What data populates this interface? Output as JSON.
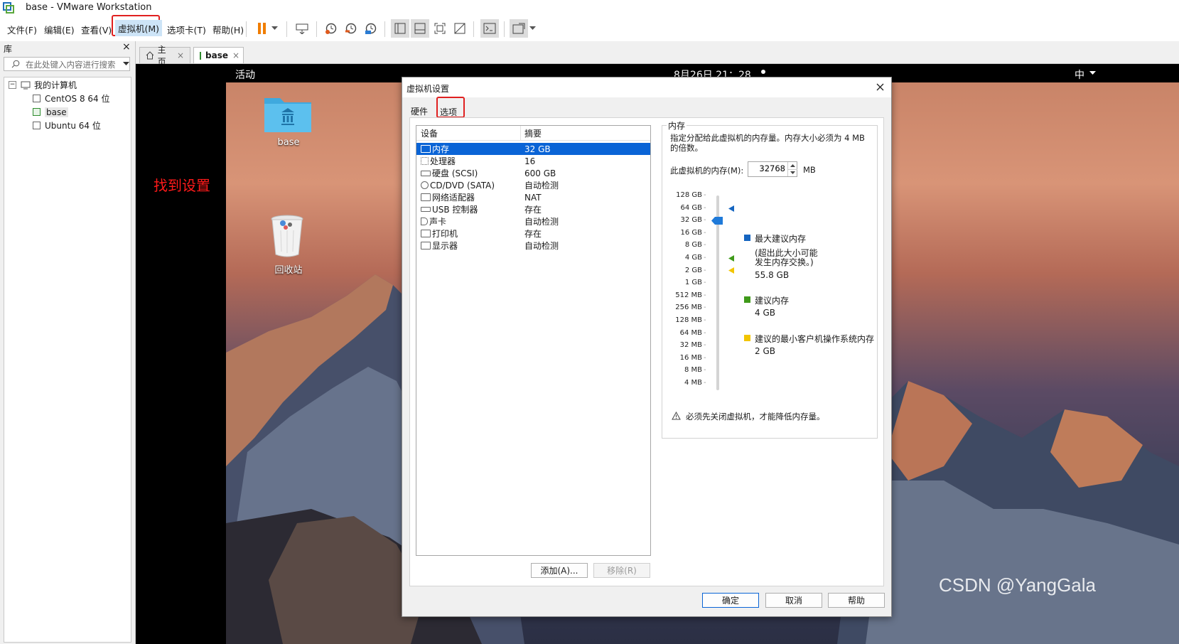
{
  "window": {
    "title": "base - VMware Workstation"
  },
  "menu": {
    "file": "文件(F)",
    "edit": "编辑(E)",
    "view": "查看(V)",
    "vm": "虚拟机(M)",
    "tabs": "选项卡(T)",
    "help": "帮助(H)"
  },
  "library": {
    "title": "库",
    "search_placeholder": "在此处键入内容进行搜索",
    "root": "我的计算机",
    "vms": [
      "CentOS 8 64 位",
      "base",
      "Ubuntu 64 位"
    ]
  },
  "tabs": {
    "home": "主页",
    "base": "base"
  },
  "guest": {
    "activities": "活动",
    "clock": "8月26日 21：28",
    "input_method": "中",
    "desktop_icons": [
      "base",
      "回收站"
    ],
    "annotation": "找到设置",
    "watermark": "CSDN @YangGala"
  },
  "dialog": {
    "title": "虚拟机设置",
    "tabs": [
      "硬件",
      "选项"
    ],
    "columns": {
      "device": "设备",
      "summary": "摘要"
    },
    "devices": [
      {
        "name": "内存",
        "summary": "32 GB",
        "icon": "memory-icon"
      },
      {
        "name": "处理器",
        "summary": "16",
        "icon": "cpu-icon"
      },
      {
        "name": "硬盘 (SCSI)",
        "summary": "600 GB",
        "icon": "disk-icon"
      },
      {
        "name": "CD/DVD (SATA)",
        "summary": "自动检测",
        "icon": "cdrom-icon"
      },
      {
        "name": "网络适配器",
        "summary": "NAT",
        "icon": "network-icon"
      },
      {
        "name": "USB 控制器",
        "summary": "存在",
        "icon": "usb-icon"
      },
      {
        "name": "声卡",
        "summary": "自动检测",
        "icon": "sound-icon"
      },
      {
        "name": "打印机",
        "summary": "存在",
        "icon": "printer-icon"
      },
      {
        "name": "显示器",
        "summary": "自动检测",
        "icon": "display-icon"
      }
    ],
    "add_button": "添加(A)...",
    "remove_button": "移除(R)",
    "memory": {
      "group_title": "内存",
      "description_line1": "指定分配给此虚拟机的内存量。内存大小必须为 4 MB",
      "description_line2": "的倍数。",
      "field_label": "此虚拟机的内存(M):",
      "value": "32768",
      "unit": "MB",
      "scale_ticks": [
        "128 GB",
        "64 GB",
        "32 GB",
        "16 GB",
        "8 GB",
        "4 GB",
        "2 GB",
        "1 GB",
        "512 MB",
        "256 MB",
        "128 MB",
        "64 MB",
        "32 MB",
        "16 MB",
        "8 MB",
        "4 MB"
      ],
      "slider_level": "32 GB",
      "legend": {
        "max_label": "最大建议内存",
        "max_note1": "(超出此大小可能",
        "max_note2": "发生内存交换。)",
        "max_value": "55.8 GB",
        "rec_label": "建议内存",
        "rec_value": "4 GB",
        "min_label": "建议的最小客户机操作系统内存",
        "min_value": "2 GB"
      },
      "warning": "必须先关闭虚拟机，才能降低内存量。"
    },
    "ok_button": "确定",
    "cancel_button": "取消",
    "help_button": "帮助"
  },
  "colors": {
    "selection": "#0a64d6",
    "highlight_box": "#e02020",
    "max_marker": "#1565c0",
    "recommended_marker": "#3f9a1a",
    "minimum_marker": "#f2c500"
  }
}
